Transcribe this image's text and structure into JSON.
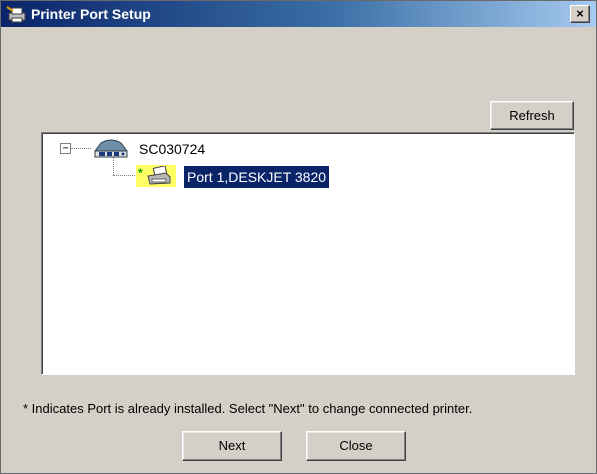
{
  "window": {
    "title": "Printer Port Setup",
    "close_glyph": "×"
  },
  "toolbar": {
    "refresh_label": "Refresh"
  },
  "tree": {
    "root": {
      "label": "SC030724",
      "icon": "network-device-icon",
      "expander": "−"
    },
    "children": [
      {
        "marker": "*",
        "icon": "printer-icon",
        "label": "Port 1,DESKJET 3820",
        "selected": true
      }
    ]
  },
  "footnote": "* Indicates Port is already installed. Select \"Next\" to change connected printer.",
  "buttons": {
    "next_label": "Next",
    "close_label": "Close"
  },
  "colors": {
    "titlebar_start": "#0a246a",
    "titlebar_end": "#a6caf0",
    "selection": "#0a246a",
    "installed_highlight": "#ffff66",
    "dialog_face": "#d4d0c8"
  }
}
